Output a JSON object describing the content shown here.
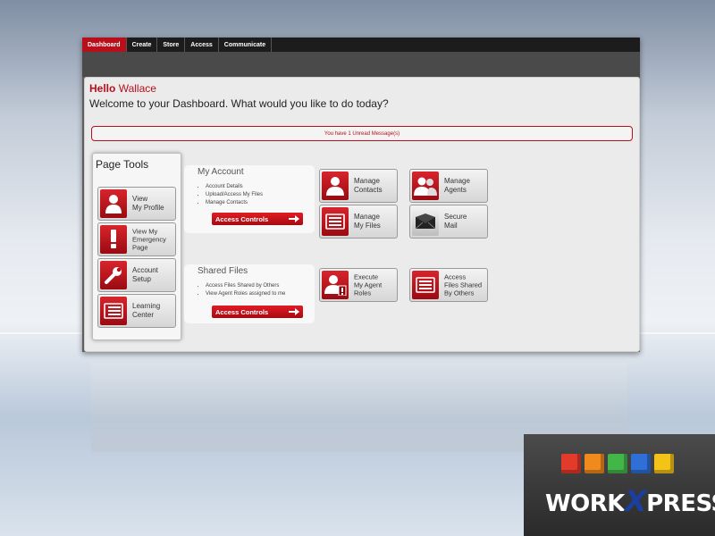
{
  "nav": {
    "tabs": [
      {
        "label": "Dashboard",
        "active": true
      },
      {
        "label": "Create",
        "active": false
      },
      {
        "label": "Store",
        "active": false
      },
      {
        "label": "Access",
        "active": false
      },
      {
        "label": "Communicate",
        "active": false
      }
    ]
  },
  "greeting": {
    "hello": "Hello",
    "user": "Wallace",
    "welcome": "Welcome to your Dashboard. What would you like to do today?"
  },
  "alert": {
    "text": "You have 1 Unread Message(s)"
  },
  "page_tools": {
    "title": "Page Tools",
    "items": [
      {
        "label": "View\nMy Profile",
        "icon": "person-icon"
      },
      {
        "label": "View My\nEmergency\nPage",
        "icon": "exclamation-icon"
      },
      {
        "label": "Account\nSetup",
        "icon": "wrench-icon"
      },
      {
        "label": "Learning\nCenter",
        "icon": "book-icon"
      }
    ]
  },
  "my_account": {
    "title": "My Account",
    "items": [
      "Account Details",
      "Upload/Access My Files",
      "Manage Contacts"
    ],
    "button": "Access Controls",
    "tiles": [
      {
        "label": "Manage\nContacts",
        "icon": "contacts-icon"
      },
      {
        "label": "Manage\nAgents",
        "icon": "agents-icon"
      },
      {
        "label": "Manage\nMy Files",
        "icon": "files-icon"
      },
      {
        "label": "Secure\nMail",
        "icon": "mail-icon"
      }
    ]
  },
  "shared_files": {
    "title": "Shared Files",
    "items": [
      "Access Files Shared by Others",
      "View Agent Roles assigned to me"
    ],
    "button": "Access Controls",
    "tiles": [
      {
        "label": "Execute\nMy Agent\nRoles",
        "icon": "agent-role-icon"
      },
      {
        "label": "Access\nFiles Shared\nBy Others",
        "icon": "shared-files-icon"
      }
    ]
  },
  "logo": {
    "text_pre": "WORK",
    "text_x": "X",
    "text_post": "PRESS",
    "reg": "®",
    "cube_colors": [
      "#e23a2b",
      "#f08a1d",
      "#43b649",
      "#2f6fd6",
      "#f3c318"
    ]
  }
}
